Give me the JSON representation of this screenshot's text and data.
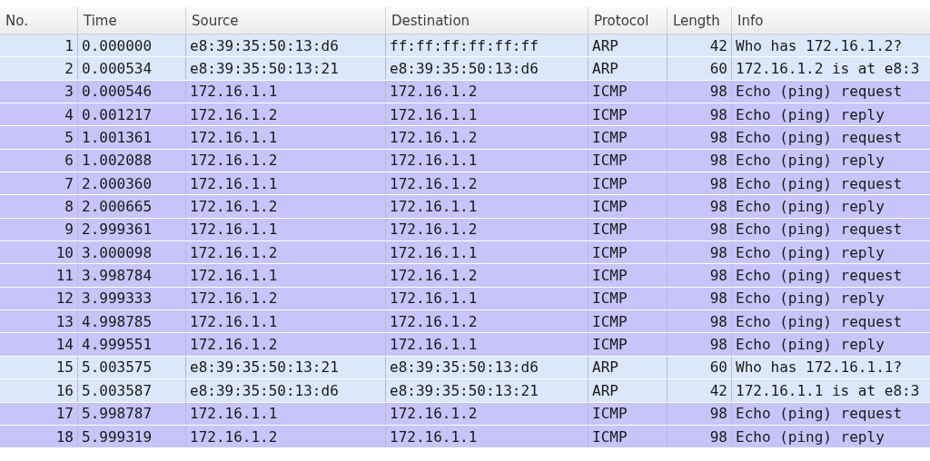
{
  "table": {
    "columns": [
      "No.",
      "Time",
      "Source",
      "Destination",
      "Protocol",
      "Length",
      "Info"
    ],
    "rows": [
      {
        "color": "#dae8fa",
        "cells": [
          "1",
          "0.000000",
          "e8:39:35:50:13:d6",
          "ff:ff:ff:ff:ff:ff",
          "ARP",
          "42",
          "Who has 172.16.1.2?"
        ]
      },
      {
        "color": "#dae8fa",
        "cells": [
          "2",
          "0.000534",
          "e8:39:35:50:13:21",
          "e8:39:35:50:13:d6",
          "ARP",
          "60",
          "172.16.1.2 is at e8:3"
        ]
      },
      {
        "color": "#c6c4f8",
        "cells": [
          "3",
          "0.000546",
          "172.16.1.1",
          "172.16.1.2",
          "ICMP",
          "98",
          "Echo (ping) request"
        ]
      },
      {
        "color": "#c6c4f8",
        "cells": [
          "4",
          "0.001217",
          "172.16.1.2",
          "172.16.1.1",
          "ICMP",
          "98",
          "Echo (ping) reply"
        ]
      },
      {
        "color": "#c6c4f8",
        "cells": [
          "5",
          "1.001361",
          "172.16.1.1",
          "172.16.1.2",
          "ICMP",
          "98",
          "Echo (ping) request"
        ]
      },
      {
        "color": "#c6c4f8",
        "cells": [
          "6",
          "1.002088",
          "172.16.1.2",
          "172.16.1.1",
          "ICMP",
          "98",
          "Echo (ping) reply"
        ]
      },
      {
        "color": "#c6c4f8",
        "cells": [
          "7",
          "2.000360",
          "172.16.1.1",
          "172.16.1.2",
          "ICMP",
          "98",
          "Echo (ping) request"
        ]
      },
      {
        "color": "#c6c4f8",
        "cells": [
          "8",
          "2.000665",
          "172.16.1.2",
          "172.16.1.1",
          "ICMP",
          "98",
          "Echo (ping) reply"
        ]
      },
      {
        "color": "#c6c4f8",
        "cells": [
          "9",
          "2.999361",
          "172.16.1.1",
          "172.16.1.2",
          "ICMP",
          "98",
          "Echo (ping) request"
        ]
      },
      {
        "color": "#c6c4f8",
        "cells": [
          "10",
          "3.000098",
          "172.16.1.2",
          "172.16.1.1",
          "ICMP",
          "98",
          "Echo (ping) reply"
        ]
      },
      {
        "color": "#c6c4f8",
        "cells": [
          "11",
          "3.998784",
          "172.16.1.1",
          "172.16.1.2",
          "ICMP",
          "98",
          "Echo (ping) request"
        ]
      },
      {
        "color": "#c6c4f8",
        "cells": [
          "12",
          "3.999333",
          "172.16.1.2",
          "172.16.1.1",
          "ICMP",
          "98",
          "Echo (ping) reply"
        ]
      },
      {
        "color": "#c6c4f8",
        "cells": [
          "13",
          "4.998785",
          "172.16.1.1",
          "172.16.1.2",
          "ICMP",
          "98",
          "Echo (ping) request"
        ]
      },
      {
        "color": "#c6c4f8",
        "cells": [
          "14",
          "4.999551",
          "172.16.1.2",
          "172.16.1.1",
          "ICMP",
          "98",
          "Echo (ping) reply"
        ]
      },
      {
        "color": "#dae8fa",
        "cells": [
          "15",
          "5.003575",
          "e8:39:35:50:13:21",
          "e8:39:35:50:13:d6",
          "ARP",
          "60",
          "Who has 172.16.1.1?"
        ]
      },
      {
        "color": "#dae8fa",
        "cells": [
          "16",
          "5.003587",
          "e8:39:35:50:13:d6",
          "e8:39:35:50:13:21",
          "ARP",
          "42",
          "172.16.1.1 is at e8:3"
        ]
      },
      {
        "color": "#c6c4f8",
        "cells": [
          "17",
          "5.998787",
          "172.16.1.1",
          "172.16.1.2",
          "ICMP",
          "98",
          "Echo (ping) request"
        ]
      },
      {
        "color": "#c6c4f8",
        "cells": [
          "18",
          "5.999319",
          "172.16.1.2",
          "172.16.1.1",
          "ICMP",
          "98",
          "Echo (ping) reply"
        ]
      }
    ]
  }
}
